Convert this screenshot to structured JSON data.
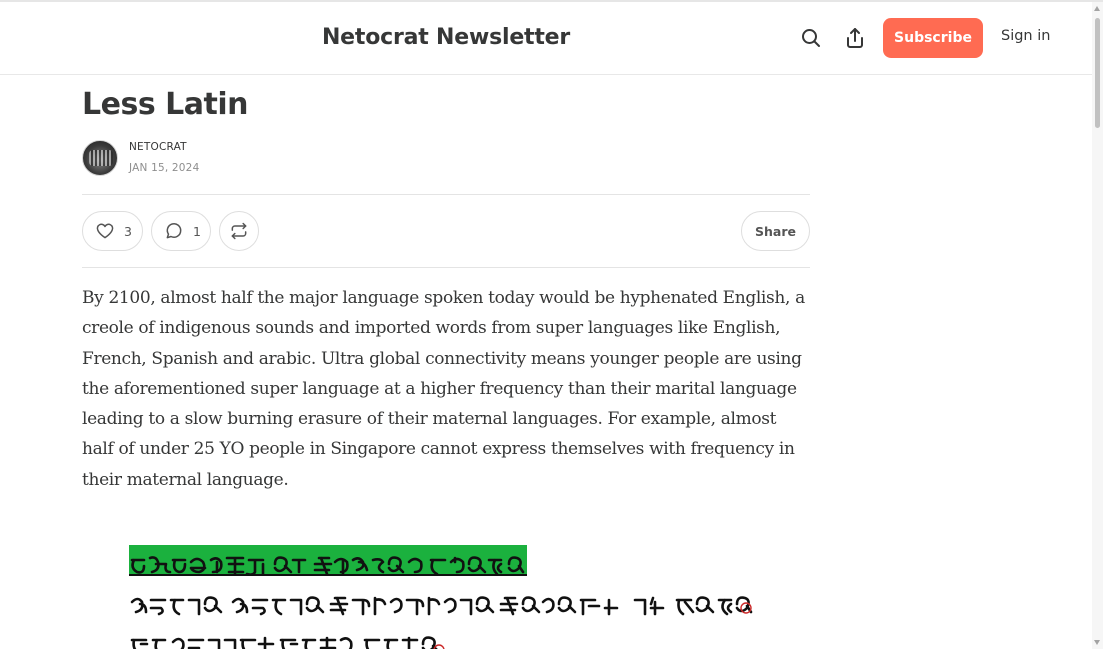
{
  "header": {
    "title": "Netocrat Newsletter",
    "subscribe_label": "Subscribe",
    "signin_label": "Sign in",
    "icons": [
      "search-icon",
      "share-upload-icon"
    ]
  },
  "post": {
    "title": "Less Latin",
    "author": "NETOCRAT",
    "date": "JAN 15, 2024",
    "likes": "3",
    "comments": "1",
    "share_label": "Share",
    "body": "By 2100, almost half the major language spoken today would be hyphenated English, a creole of indigenous sounds and imported words from super languages like English, French, Spanish and arabic. Ultra global connectivity means younger people are using the aforementioned super language at a higher frequency than their marital language leading to a slow burning erasure of their maternal languages. For example, almost half of under 25 YO people in Singapore cannot express themselves with frequency in their maternal language."
  },
  "colors": {
    "accent": "#ff6b52",
    "highlight": "#1bb13e",
    "text": "#363737",
    "muted": "#8e8e8e"
  }
}
